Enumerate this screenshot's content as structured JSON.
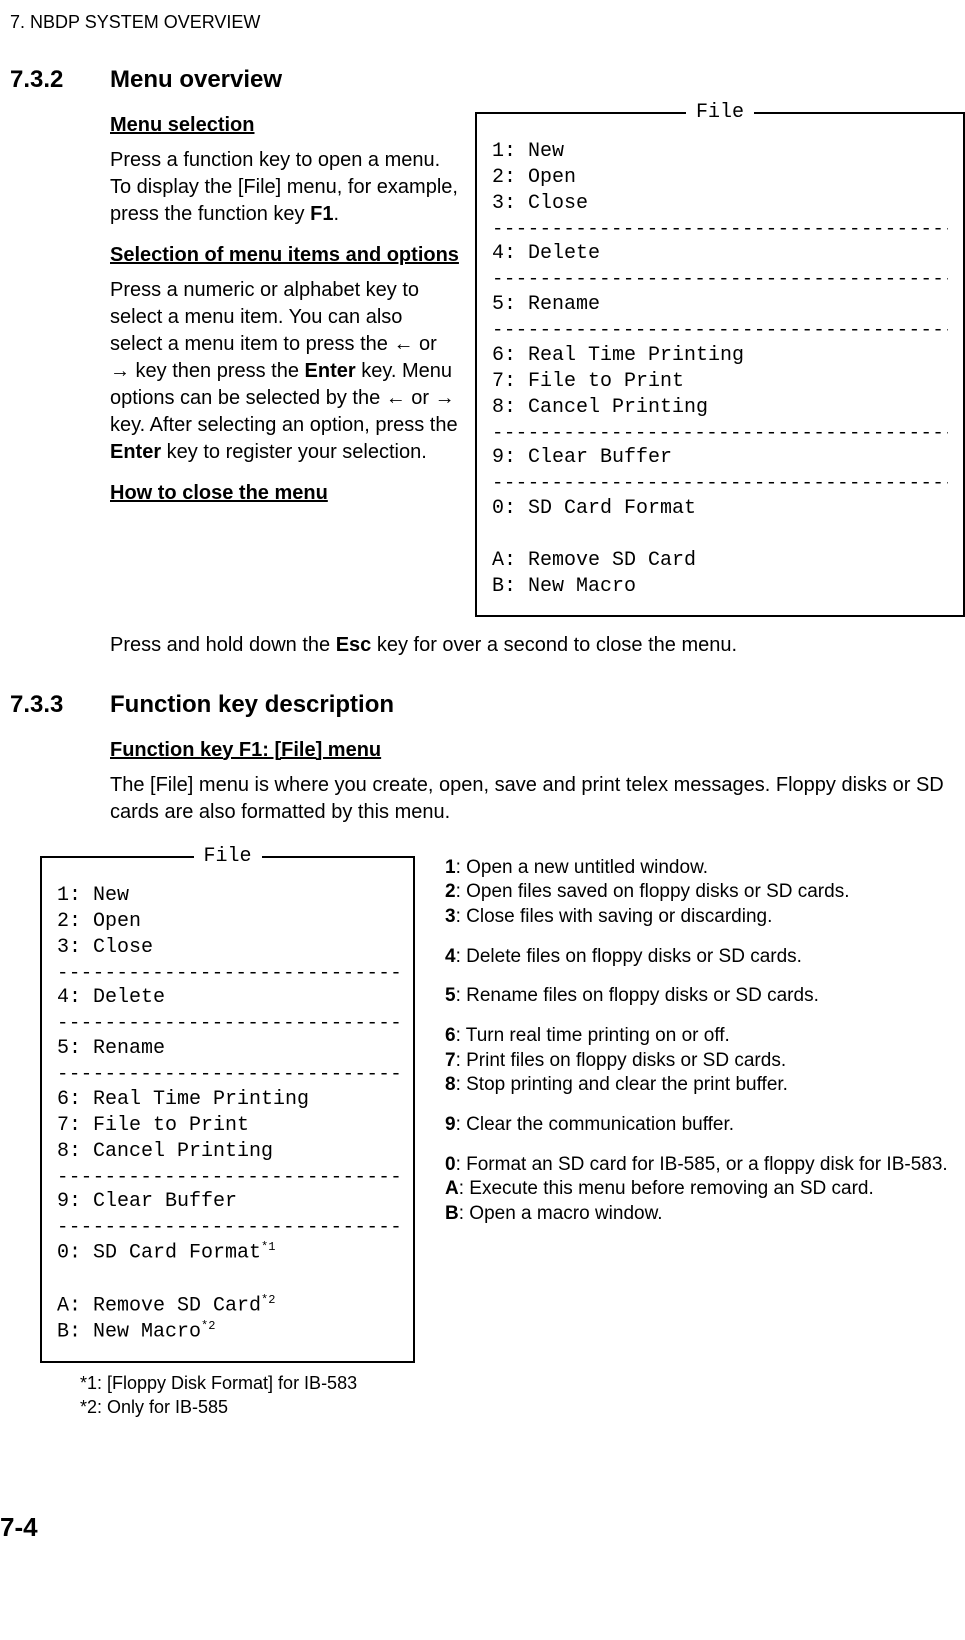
{
  "header": "7.  NBDP SYSTEM OVERVIEW",
  "section1_num": "7.3.2",
  "section1_title": "Menu overview",
  "sub1": "Menu selection",
  "para1a": "Press a function key to open a menu. To display the [File] menu, for example, press the function key ",
  "para1b": "F1",
  "para1c": ".",
  "sub2": "Selection of menu items and options",
  "para2a": "Press a numeric or alphabet key to select a menu item. You can also select a menu item to press the ",
  "arrL": "←",
  "para2b": " or ",
  "arrR": "→",
  "para2c": " key then press the ",
  "enter": "Enter",
  "para2d": " key. Menu options can be selected by the ",
  "para2e": " key. After selecting an option, press the ",
  "para2f": " key to register your selection.",
  "sub3": "How to close the menu",
  "para3a": "Press and hold down the ",
  "esc": "Esc",
  "para3b": " key for over a second to close the menu.",
  "file_title": "File",
  "m1": "1: New",
  "m2": "2: Open",
  "m3": "3: Close",
  "m4": "4: Delete",
  "m5": "5: Rename",
  "m6": "6: Real Time Printing",
  "m7": "7: File to Print",
  "m8": "8: Cancel Printing",
  "m9": "9: Clear Buffer",
  "m0": "0: SD Card Format",
  "mA": "A: Remove SD Card",
  "mB": "B: New Macro",
  "dash": "-----------------------------------------",
  "section2_num": "7.3.3",
  "section2_title": "Function key description",
  "sub4": "Function key F1: [File] menu",
  "para4": "The [File] menu is where you create, open, save and print telex messages. Floppy disks or SD cards are also formatted by this menu.",
  "m0s": "0: SD Card Format",
  "mAs": "A: Remove SD Card",
  "mBs": "B: New Macro",
  "star1": "*1",
  "star2": "*2",
  "note1": "*1: [Floppy Disk Format] for IB-583",
  "note2": "*2: Only for IB-585",
  "d1a": "1",
  "d1b": ": Open a new untitled window.",
  "d2a": "2",
  "d2b": ": Open files saved on floppy disks or SD cards.",
  "d3a": "3",
  "d3b": ": Close files with saving or discarding.",
  "d4a": "4",
  "d4b": ": Delete files on floppy disks or SD cards.",
  "d5a": "5",
  "d5b": ": Rename files on floppy disks or SD cards.",
  "d6a": "6",
  "d6b": ": Turn real time printing on or off.",
  "d7a": "7",
  "d7b": ": Print files on floppy disks or SD cards.",
  "d8a": "8",
  "d8b": ": Stop printing and clear the print buffer.",
  "d9a": "9",
  "d9b": ": Clear the communication buffer.",
  "d0a": "0",
  "d0b": ": Format an SD card for IB-585, or a floppy disk for IB-583.",
  "dAa": "A",
  "dAb": ": Execute this menu before removing an SD card.",
  "dBa": "B",
  "dBb": ": Open a macro window.",
  "pagenum": "7-4"
}
